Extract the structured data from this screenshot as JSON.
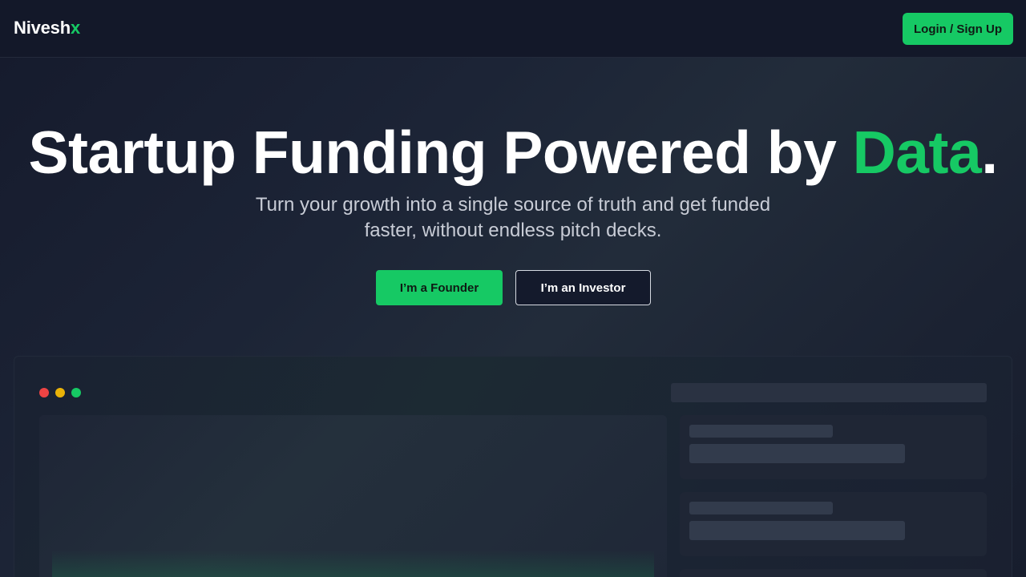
{
  "nav": {
    "logo_main": "Nivesh",
    "logo_accent": "x",
    "login_label": "Login / Sign Up"
  },
  "hero": {
    "title_main": "Startup Funding Powered by ",
    "title_accent": "Data",
    "title_end": ".",
    "subtitle_line1": "Turn your growth into a single source of truth and get funded",
    "subtitle_line2": "faster, without endless pitch decks.",
    "founder_label": "I’m a Founder",
    "investor_label": "I’m an Investor"
  },
  "colors": {
    "accent": "#16c964",
    "background": "#141a2b",
    "window_dot_red": "#ee4444",
    "window_dot_yellow": "#eab308",
    "window_dot_green": "#16c964"
  }
}
